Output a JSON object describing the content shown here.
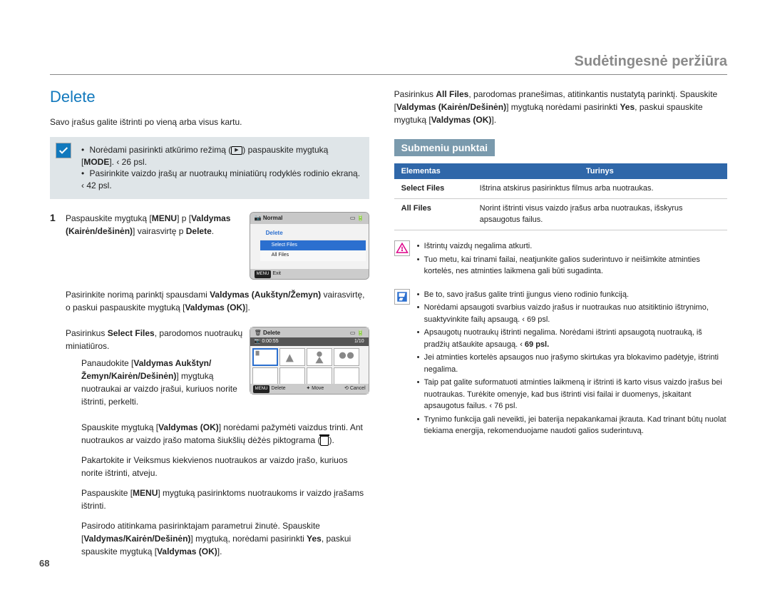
{
  "header": "Sudėtingesnė peržiūra",
  "page_number": "68",
  "left": {
    "title": "Delete",
    "intro": "Savo įrašus galite ištrinti po vieną arba visus kartu.",
    "info_bullet1_pre": "Norėdami pasirinkti atkūrimo režimą (",
    "info_bullet1_post": ") paspauskite mygtuką [",
    "info_bullet1_bold": "MODE",
    "info_bullet1_end": "]. ‹ 26 psl.",
    "info_bullet2": "Pasirinkite vaizdo įrašų ar nuotraukų miniatiūrų rodyklės rodinio ekraną. ‹ 42 psl.",
    "step1_a": "Paspauskite mygtuką [",
    "step1_b": "MENU",
    "step1_c": "] p [",
    "step1_d": "Valdymas (Kairėn/dešinėn)",
    "step1_e": "] vairasvirtę p ",
    "step1_f": "Delete",
    "step1_g": ".",
    "step2_a": "Pasirinkite norimą parinktį spausdami ",
    "step2_b": "Valdymas (Aukštyn/Žemyn)",
    "step2_c": " vairasvirtę, o paskui paspauskite mygtuką [",
    "step2_d": "Valdymas (OK)",
    "step2_e": "].",
    "step3_a": "Pasirinkus ",
    "step3_b": "Select Files",
    "step3_c": ", parodomos nuotraukų miniatiūros.",
    "sub_a": "Panaudokite [",
    "sub_a2": "Valdymas Aukštyn/Žemyn/Kairėn/Dešinėn)",
    "sub_a3": "] mygtuką nuotraukai ar vaizdo įrašui, kuriuos norite ištrinti, perkelti.",
    "sub_b": "Spauskite mygtuką [",
    "sub_b2": "Valdymas (OK)",
    "sub_b3": "] norėdami pažymėti vaizdus trinti. Ant nuotraukos ar vaizdo įrašo matoma šiukšlių dėžės piktograma (",
    "sub_b4": ").",
    "sub_c": "Pakartokite     ir     Veiksmus kiekvienos nuotraukos ar vaizdo įrašo, kuriuos norite ištrinti, atveju.",
    "sub_d": "Paspauskite [",
    "sub_d2": "MENU",
    "sub_d3": "] mygtuką pasirinktoms nuotraukoms ir vaizdo įrašams ištrinti.",
    "sub_e": "Pasirodo atitinkama pasirinktajam parametrui žinutė. Spauskite [",
    "sub_e2": "Valdymas/Kairėn/Dešinėn)",
    "sub_e3": "] mygtuką, norėdami pasirinkti ",
    "sub_e4": "Yes",
    "sub_e5": ", paskui spauskite mygtuką [",
    "sub_e6": "Valdymas (OK)",
    "sub_e7": "].",
    "mock1": {
      "normal": "Normal",
      "delete": "Delete",
      "sel": "Select Files",
      "all": "All Files",
      "exit": "Exit"
    },
    "mock2": {
      "title": "Delete",
      "time": "0:00:55",
      "count": "1/10",
      "del": "Delete",
      "move": "Move",
      "cancel": "Cancel"
    }
  },
  "right": {
    "p1_a": "Pasirinkus ",
    "p1_b": "All Files",
    "p1_c": ", parodomas pranešimas, atitinkantis nustatytą parinktį. Spauskite [",
    "p1_d": "Valdymas (Kairėn/Dešinėn)",
    "p1_e": "] mygtuką norėdami pasirinkti ",
    "p1_f": "Yes",
    "p1_g": ", paskui spauskite mygtuką [",
    "p1_h": "Valdymas (OK)",
    "p1_i": "].",
    "sub_heading": "Submeniu punktai",
    "th1": "Elementas",
    "th2": "Turinys",
    "row1_k": "Select Files",
    "row1_v": "Ištrina atskirus pasirinktus filmus arba nuotraukas.",
    "row2_k": "All Files",
    "row2_v": "Norint ištrinti visus vaizdo įrašus arba nuotraukas, išskyrus apsaugotus failus.",
    "warn1": "Ištrintų vaizdų negalima atkurti.",
    "warn2": "Tuo metu, kai trinami failai, neatjunkite galios suderintuvo ir neišimkite atminties kortelės, nes atminties laikmena gali būti sugadinta.",
    "tip1": "Be to, savo įrašus galite trinti įjungus vieno rodinio funkciją.",
    "tip2": "Norėdami apsaugoti svarbius vaizdo įrašus ir nuotraukas nuo atsitiktinio ištrynimo, suaktyvinkite failų apsaugą. ‹ 69 psl.",
    "tip3_a": "Apsaugotų nuotraukų ištrinti negalima. Norėdami ištrinti apsaugotą nuotrauką, iš pradžių atšaukite apsaugą. ‹ ",
    "tip3_b": "69 psl.",
    "tip4": "Jei atminties kortelės apsaugos nuo įrašymo skirtukas yra blokavimo padėtyje, ištrinti negalima.",
    "tip5": "Taip pat galite suformatuoti atminties laikmeną ir ištrinti iš karto visus vaizdo įrašus bei nuotraukas. Turėkite omenyje, kad bus ištrinti visi failai ir duomenys, įskaitant apsaugotus failus. ‹ 76 psl.",
    "tip6": "Trynimo funkcija gali neveikti, jei baterija nepakankamai įkrauta. Kad trinant būtų nuolat tiekiama energija, rekomenduojame naudoti galios suderintuvą."
  }
}
